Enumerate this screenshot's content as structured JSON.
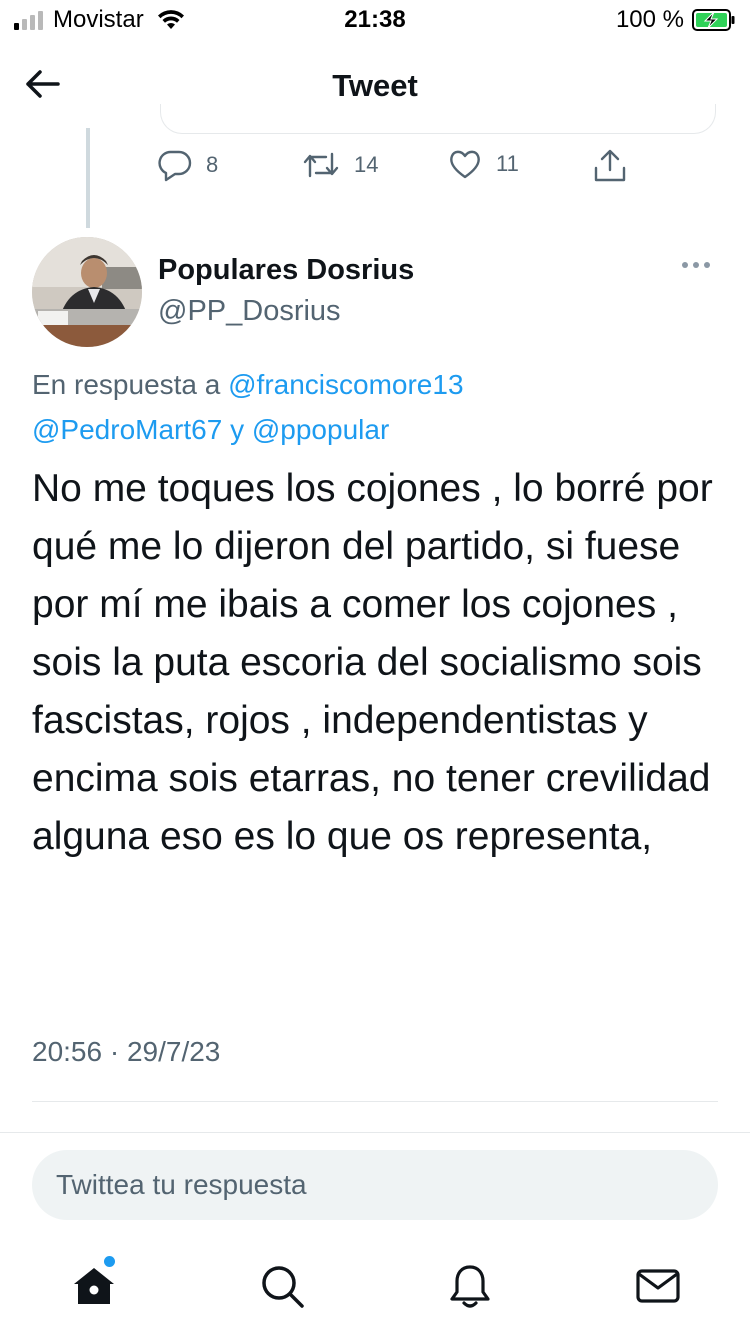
{
  "status_bar": {
    "carrier": "Movistar",
    "time": "21:38",
    "battery": "100 %"
  },
  "nav": {
    "title": "Tweet"
  },
  "previous_tweet": {
    "reply_count": "8",
    "retweet_count": "14",
    "like_count": "11"
  },
  "tweet": {
    "author_name": "Populares Dosrius",
    "author_handle": "@PP_Dosrius",
    "reply_prefix": "En respuesta a ",
    "reply_mentions": [
      "@franciscomore13",
      "@PedroMart67",
      "@ppopular"
    ],
    "reply_joiner": " y ",
    "text": "No me toques los cojones , lo borré por qué me lo dijeron del partido, si fuese por mí me ibais a comer los cojones , sois la puta escoria del socialismo sois fascistas, rojos , independentistas y encima sois etarras, no tener crevilidad alguna eso es lo que os representa,",
    "timestamp": "20:56 · 29/7/23"
  },
  "reply_input": {
    "placeholder": "Twittea tu respuesta"
  },
  "tabbar": {
    "items": [
      "home-icon",
      "search-icon",
      "notifications-icon",
      "messages-icon"
    ]
  },
  "colors": {
    "accent": "#1d9bf0",
    "secondary_text": "#536471",
    "text": "#0f1419"
  }
}
